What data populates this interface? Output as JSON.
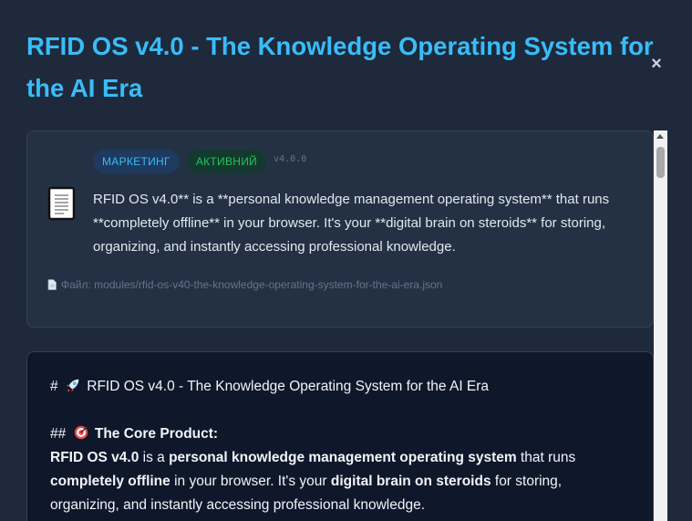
{
  "modal": {
    "title": "RFID OS v4.0 - The Knowledge Operating System for the AI Era",
    "close_label": "×"
  },
  "card": {
    "category_badge": "МАРКЕТИНГ",
    "status_badge": "АКТИВНИЙ",
    "version": "v4.0.0",
    "summary": "RFID OS v4.0** is a **personal knowledge management operating system** that runs **completely offline** in your browser. It's your **digital brain on steroids** for storing, organizing, and instantly accessing professional knowledge.",
    "file_path": "Файл: modules/rfid-os-v40-the-knowledge-operating-system-for-the-ai-era.json"
  },
  "content": {
    "h1_prefix": "#",
    "h1_text": "RFID OS v4.0 - The Knowledge Operating System for the AI Era",
    "h2_prefix": "##",
    "h2_text": "The Core Product:",
    "p_bold_1": "RFID OS v4.0",
    "p_text_1": " is a ",
    "p_bold_2": "personal knowledge management operating system",
    "p_text_2": " that runs ",
    "p_bold_3": "completely offline",
    "p_text_3": " in your browser. It's your ",
    "p_bold_4": "digital brain on steroids",
    "p_text_4": " for storing, organizing, and instantly accessing professional knowledge."
  },
  "icons": {
    "document": "document-icon",
    "file": "file-icon",
    "rocket": "rocket-icon",
    "target": "target-icon",
    "close": "close-icon"
  },
  "colors": {
    "background": "#1e293b",
    "title": "#38bdf8",
    "card": "#243144",
    "panel": "#0f172a",
    "badge_category": "#38bdf8",
    "badge_status": "#22c55e"
  }
}
